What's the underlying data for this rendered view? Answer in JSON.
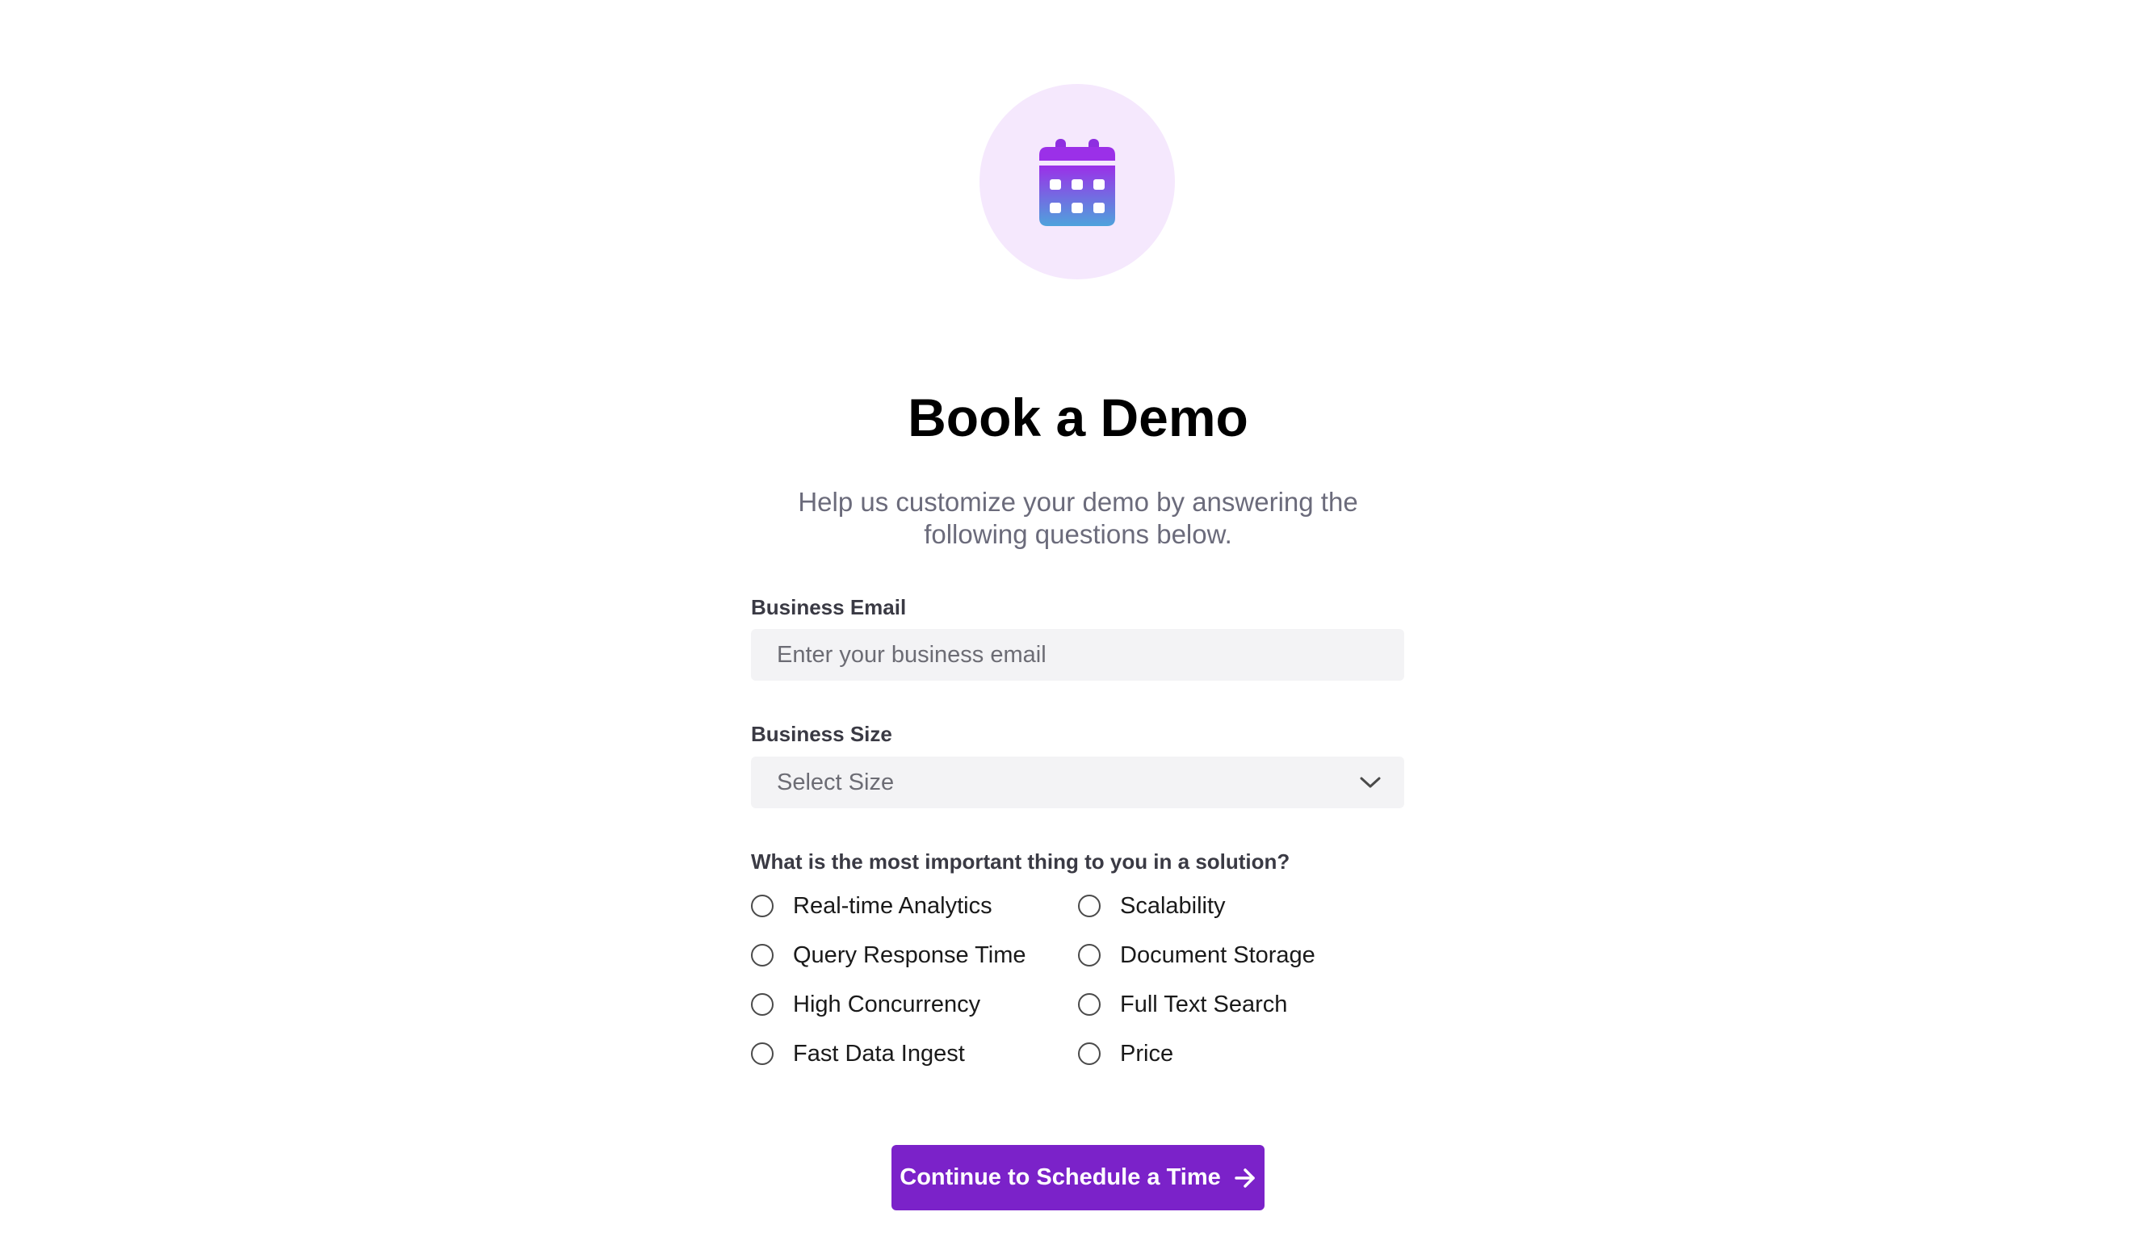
{
  "header": {
    "icon": "calendar-icon",
    "title": "Book a Demo",
    "subtitle": "Help us customize your demo by answering the following questions below."
  },
  "form": {
    "email": {
      "label": "Business Email",
      "placeholder": "Enter your business email",
      "value": ""
    },
    "size": {
      "label": "Business Size",
      "selected": "Select Size"
    },
    "question": {
      "label": "What is the most important thing to you in a solution?",
      "options": [
        "Real-time Analytics",
        "Query Response Time",
        "High Concurrency",
        "Fast Data Ingest",
        "Scalability",
        "Document Storage",
        "Full Text Search",
        "Price"
      ]
    },
    "submit_label": "Continue to Schedule a Time"
  },
  "colors": {
    "accent": "#7b22c9",
    "icon_circle_bg": "#f5e8fd",
    "icon_gradient_top": "#9b30e8",
    "icon_gradient_bottom": "#4ea3dc",
    "input_bg": "#f3f3f5",
    "subtitle_text": "#6b6b7b"
  }
}
